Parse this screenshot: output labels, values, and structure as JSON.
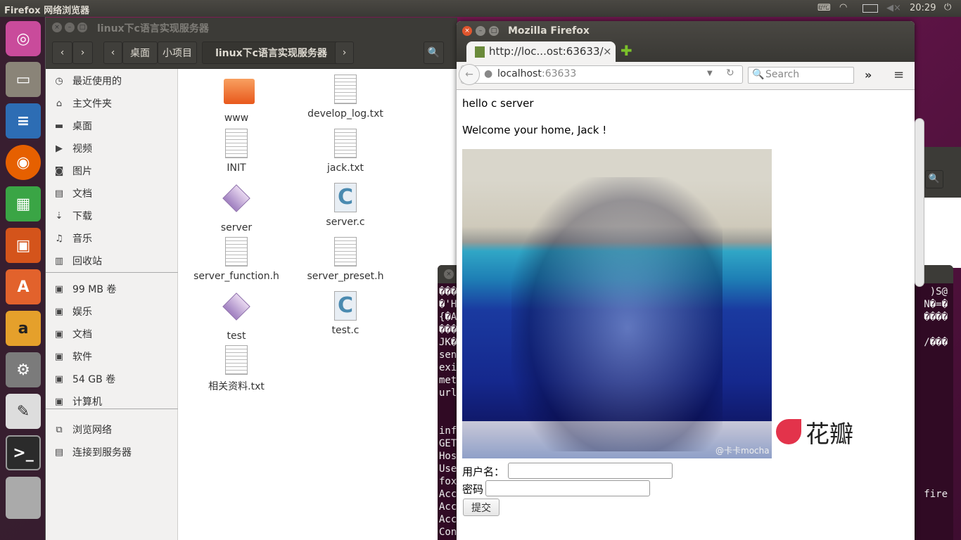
{
  "top_panel": {
    "app_name": "Firefox 网络浏览器",
    "time": "20:29",
    "icons": [
      "keyboard-icon",
      "wifi-icon",
      "battery-icon",
      "volume-muted-icon",
      "power-icon"
    ]
  },
  "launcher": {
    "items": [
      "ubuntu-dash",
      "files",
      "libreoffice-writer",
      "firefox",
      "libreoffice-calc",
      "libreoffice-impress",
      "ubuntu-software-center",
      "amazon",
      "system-settings",
      "text-editor",
      "terminal",
      "workspaces"
    ]
  },
  "file_manager": {
    "title": "linux下c语言实现服务器",
    "breadcrumb": [
      "桌面",
      "小项目",
      "linux下c语言实现服务器"
    ],
    "sidebar": [
      {
        "icon": "clock-icon",
        "label": "最近使用的"
      },
      {
        "icon": "home-icon",
        "label": "主文件夹"
      },
      {
        "icon": "folder-icon",
        "label": "桌面"
      },
      {
        "icon": "video-icon",
        "label": "视频"
      },
      {
        "icon": "camera-icon",
        "label": "图片"
      },
      {
        "icon": "document-icon",
        "label": "文档"
      },
      {
        "icon": "download-icon",
        "label": "下载"
      },
      {
        "icon": "music-icon",
        "label": "音乐"
      },
      {
        "icon": "trash-icon",
        "label": "回收站"
      },
      {
        "icon": "drive-icon",
        "label": "99 MB 卷"
      },
      {
        "icon": "drive-icon",
        "label": "娱乐"
      },
      {
        "icon": "drive-icon",
        "label": "文档"
      },
      {
        "icon": "drive-icon",
        "label": "软件"
      },
      {
        "icon": "drive-icon",
        "label": "54 GB 卷"
      },
      {
        "icon": "drive-icon",
        "label": "计算机"
      },
      {
        "icon": "network-icon",
        "label": "浏览网络"
      },
      {
        "icon": "server-icon",
        "label": "连接到服务器"
      }
    ],
    "files": [
      {
        "name": "www",
        "type": "folder"
      },
      {
        "name": "develop_log.txt",
        "type": "text"
      },
      {
        "name": "INIT",
        "type": "text"
      },
      {
        "name": "jack.txt",
        "type": "text"
      },
      {
        "name": "server",
        "type": "executable"
      },
      {
        "name": "server.c",
        "type": "c-source"
      },
      {
        "name": "server_function.h",
        "type": "header"
      },
      {
        "name": "server_preset.h",
        "type": "header"
      },
      {
        "name": "test",
        "type": "executable"
      },
      {
        "name": "test.c",
        "type": "c-source"
      },
      {
        "name": "相关资料.txt",
        "type": "text"
      }
    ]
  },
  "terminal": {
    "left_lines": [
      "���",
      "�'H",
      "{�A",
      "���",
      "JK�",
      "sen",
      "exi",
      "met",
      "url",
      "",
      "",
      "inf",
      "GET",
      "Hos",
      "Use",
      "fox",
      "Acc",
      "Acc",
      "Acc",
      "Con"
    ],
    "right_lines": [
      ")S@",
      "N�=�",
      "����",
      "",
      "/���",
      "",
      "",
      "",
      "",
      "",
      "",
      "",
      "",
      "",
      "fire"
    ]
  },
  "firefox": {
    "title": "Mozilla Firefox",
    "tab_title": "http://loc...ost:63633/",
    "url_host": "localhost",
    "url_port": ":63633",
    "search_placeholder": "Search",
    "page": {
      "line1": "hello c server",
      "line2": "Welcome your home, Jack !",
      "image_watermark": "@卡卡mocha",
      "logo_text": "花瓣",
      "username_label": "用户名：",
      "password_label": "密码",
      "submit_label": "提交"
    }
  }
}
